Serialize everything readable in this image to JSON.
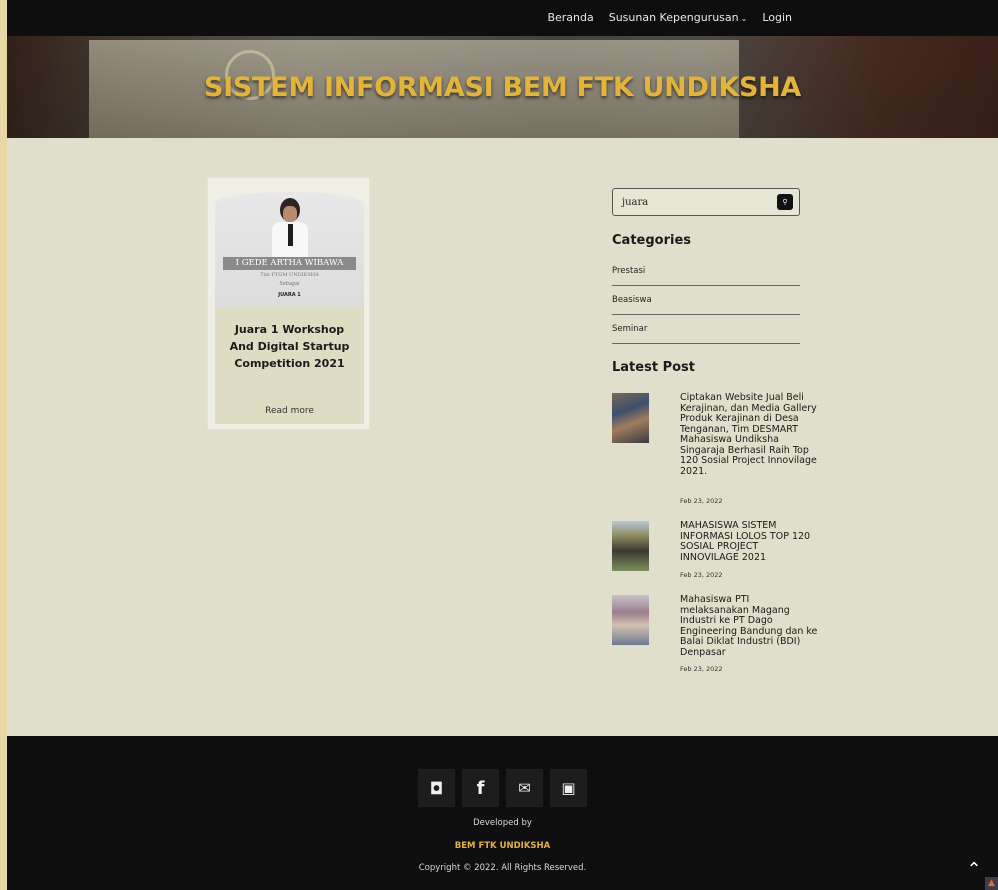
{
  "nav": {
    "items": [
      {
        "label": "Beranda"
      },
      {
        "label": "Susunan Kepengurusan",
        "chevron": "chevron-down-icon"
      },
      {
        "label": "Login"
      }
    ]
  },
  "hero": {
    "title": "SISTEM INFORMASI BEM FTK UNDIKSHA"
  },
  "post_card": {
    "thumbnail": {
      "name": "I GEDE ARTHA WIBAWA",
      "subtitle": "Tim FTGM UNDIKSHA",
      "caption": "Sebagai",
      "award": "JUARA 1"
    },
    "title": "Juara 1 Workshop And Digital Startup Competition 2021",
    "read_more": "Read more"
  },
  "sidebar": {
    "search": {
      "value": "juara",
      "icon": "search-icon"
    },
    "categories_heading": "Categories",
    "categories": [
      {
        "label": "Prestasi"
      },
      {
        "label": "Beasiswa"
      },
      {
        "label": "Seminar"
      }
    ],
    "latest_heading": "Latest Post",
    "latest_posts": [
      {
        "title": "Ciptakan Website Jual Beli Kerajinan, dan Media Gallery Produk Kerajinan di Desa Tenganan, Tim DESMART Mahasiswa Undiksha Singaraja Berhasil Raih Top 120 Sosial Project Innovilage 2021.",
        "date": "Feb 23, 2022"
      },
      {
        "title": "MAHASISWA SISTEM INFORMASI LOLOS TOP 120 SOSIAL PROJECT INNOVILAGE 2021",
        "date": "Feb 23, 2022"
      },
      {
        "title": "Mahasiswa PTI melaksanakan Magang Industri ke PT Dago Engineering Bandung dan ke Balai Diklat Industri (BDI) Denpasar",
        "date": "Feb 23, 2022"
      }
    ]
  },
  "footer": {
    "social": [
      {
        "icon": "instagram-icon",
        "glyph": "◘"
      },
      {
        "icon": "facebook-icon",
        "glyph": "f"
      },
      {
        "icon": "mail-icon",
        "glyph": "✉"
      },
      {
        "icon": "youtube-icon",
        "glyph": "▣"
      }
    ],
    "developed_by": "Developed by",
    "brand": "BEM FTK UNDIKSHA",
    "copyright": "Copyright © 2022. All Rights Reserved."
  },
  "colors": {
    "accent": "#e3b43c",
    "navbar": "#0e0e0e",
    "content_bg": "#dfdfcb",
    "footer": "#0f0f0f"
  }
}
